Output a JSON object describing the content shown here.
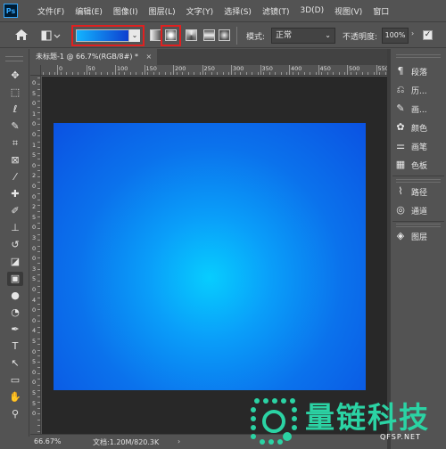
{
  "app": {
    "logo_text": "Ps"
  },
  "menu": [
    "文件(F)",
    "编辑(E)",
    "图像(I)",
    "图层(L)",
    "文字(Y)",
    "选择(S)",
    "滤镜(T)",
    "3D(D)",
    "视图(V)",
    "窗口"
  ],
  "options_bar": {
    "gradient_colors": [
      "#12b4ff",
      "#0e3fcf"
    ],
    "gradient_types": [
      "linear",
      "radial",
      "angle",
      "reflected",
      "diamond"
    ],
    "selected_gradient_type": "radial",
    "mode_label": "模式:",
    "mode_value": "正常",
    "opacity_label": "不透明度:",
    "opacity_value": "100%",
    "reverse_checked": true
  },
  "document": {
    "tab_title": "未标题-1 @ 66.7%(RGB/8#) *",
    "close_glyph": "×",
    "canvas_gradient": {
      "type": "radial",
      "center_color": "#07cdfe",
      "edge_color": "#0b52e2"
    }
  },
  "rulers": {
    "horizontal_labels": [
      "0",
      "50",
      "100",
      "150",
      "200",
      "250",
      "300",
      "350",
      "400",
      "450",
      "500",
      "550"
    ],
    "vertical_labels": [
      "0",
      "5",
      "0",
      "1",
      "0",
      "0",
      "1",
      "5",
      "0",
      "2",
      "0",
      "0",
      "2",
      "5",
      "0",
      "3",
      "0",
      "0",
      "3",
      "5",
      "0",
      "4",
      "0",
      "0",
      "4",
      "5",
      "0",
      "5",
      "0",
      "0",
      "5",
      "5",
      "0"
    ]
  },
  "status_bar": {
    "zoom": "66.67%",
    "doc_info": "文档:1.20M/820.3K",
    "arrow": "›"
  },
  "tools": [
    "move",
    "marquee",
    "lasso",
    "quick-select",
    "crop",
    "frame",
    "eyedropper",
    "healing",
    "brush",
    "clone-stamp",
    "history-brush",
    "eraser",
    "gradient",
    "blur",
    "dodge",
    "pen",
    "type",
    "path-select",
    "rectangle",
    "hand",
    "zoom"
  ],
  "panels": {
    "group1": [
      {
        "icon": "paragraph-icon",
        "label": "段落"
      },
      {
        "icon": "history-icon",
        "label": "历..."
      },
      {
        "icon": "brush-preset-icon",
        "label": "画..."
      },
      {
        "icon": "color-icon",
        "label": "颜色"
      },
      {
        "icon": "brush-settings-icon",
        "label": "画笔"
      },
      {
        "icon": "swatches-icon",
        "label": "色板"
      }
    ],
    "group2": [
      {
        "icon": "paths-icon",
        "label": "路径"
      },
      {
        "icon": "channels-icon",
        "label": "通道"
      }
    ],
    "group3": [
      {
        "icon": "layers-icon",
        "label": "图层"
      }
    ]
  },
  "watermark": {
    "title": "量链科技",
    "url": "QFSP.NET",
    "color": "#2bd3a4"
  }
}
